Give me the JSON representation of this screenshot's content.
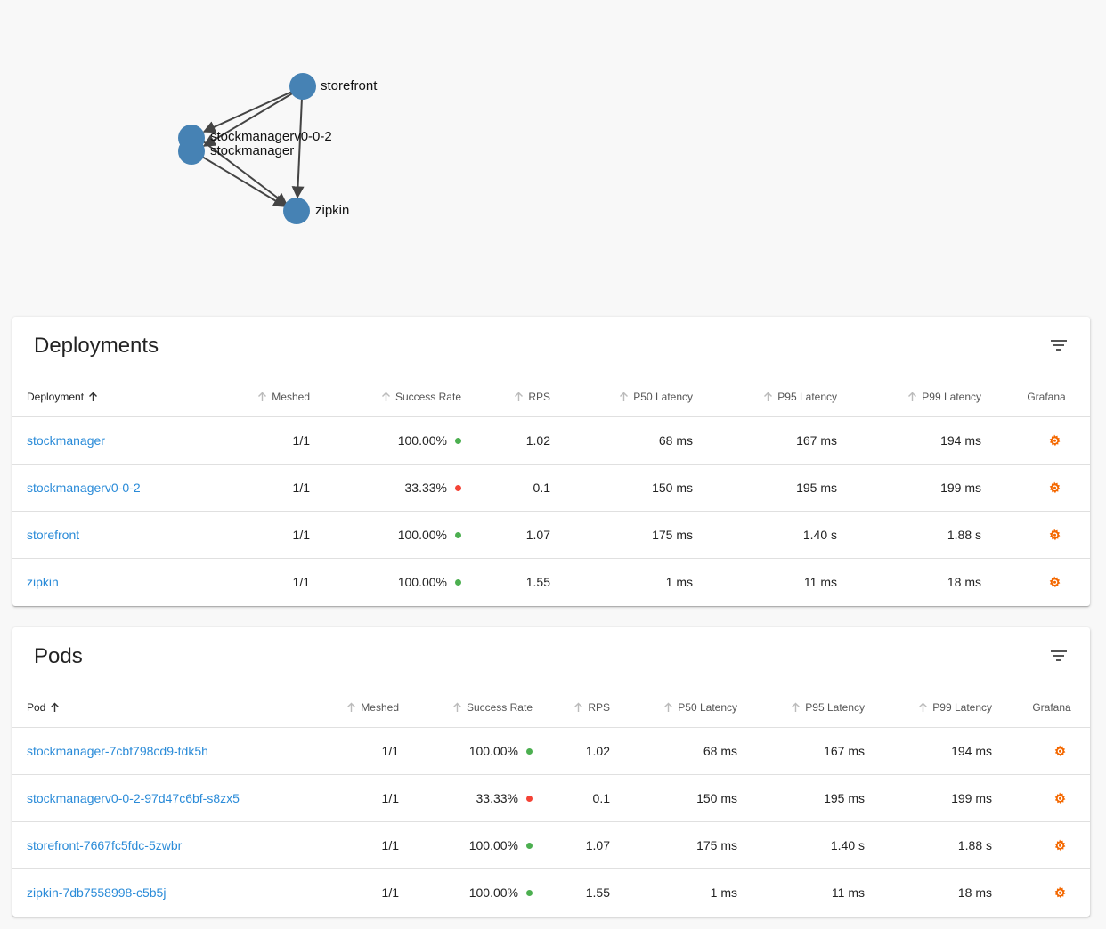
{
  "colors": {
    "node": "#4682b4",
    "link": "#2a8bd8",
    "success": "#4caf50",
    "failure": "#f44336",
    "grafana": "#f46800"
  },
  "graph": {
    "nodes": [
      "storefront",
      "stockmanagerv0-0-2",
      "stockmanager",
      "zipkin"
    ]
  },
  "deployments": {
    "title": "Deployments",
    "filter_icon": "filter-icon",
    "columns": [
      "Deployment",
      "Meshed",
      "Success Rate",
      "RPS",
      "P50 Latency",
      "P95 Latency",
      "P99 Latency",
      "Grafana"
    ],
    "rows": [
      {
        "name": "stockmanager",
        "meshed": "1/1",
        "success_rate": "100.00%",
        "status": "success",
        "rps": "1.02",
        "p50": "68 ms",
        "p95": "167 ms",
        "p99": "194 ms"
      },
      {
        "name": "stockmanagerv0-0-2",
        "meshed": "1/1",
        "success_rate": "33.33%",
        "status": "failure",
        "rps": "0.1",
        "p50": "150 ms",
        "p95": "195 ms",
        "p99": "199 ms"
      },
      {
        "name": "storefront",
        "meshed": "1/1",
        "success_rate": "100.00%",
        "status": "success",
        "rps": "1.07",
        "p50": "175 ms",
        "p95": "1.40 s",
        "p99": "1.88 s"
      },
      {
        "name": "zipkin",
        "meshed": "1/1",
        "success_rate": "100.00%",
        "status": "success",
        "rps": "1.55",
        "p50": "1 ms",
        "p95": "11 ms",
        "p99": "18 ms"
      }
    ]
  },
  "pods": {
    "title": "Pods",
    "filter_icon": "filter-icon",
    "columns": [
      "Pod",
      "Meshed",
      "Success Rate",
      "RPS",
      "P50 Latency",
      "P95 Latency",
      "P99 Latency",
      "Grafana"
    ],
    "rows": [
      {
        "name": "stockmanager-7cbf798cd9-tdk5h",
        "meshed": "1/1",
        "success_rate": "100.00%",
        "status": "success",
        "rps": "1.02",
        "p50": "68 ms",
        "p95": "167 ms",
        "p99": "194 ms"
      },
      {
        "name": "stockmanagerv0-0-2-97d47c6bf-s8zx5",
        "meshed": "1/1",
        "success_rate": "33.33%",
        "status": "failure",
        "rps": "0.1",
        "p50": "150 ms",
        "p95": "195 ms",
        "p99": "199 ms"
      },
      {
        "name": "storefront-7667fc5fdc-5zwbr",
        "meshed": "1/1",
        "success_rate": "100.00%",
        "status": "success",
        "rps": "1.07",
        "p50": "175 ms",
        "p95": "1.40 s",
        "p99": "1.88 s"
      },
      {
        "name": "zipkin-7db7558998-c5b5j",
        "meshed": "1/1",
        "success_rate": "100.00%",
        "status": "success",
        "rps": "1.55",
        "p50": "1 ms",
        "p95": "11 ms",
        "p99": "18 ms"
      }
    ]
  }
}
